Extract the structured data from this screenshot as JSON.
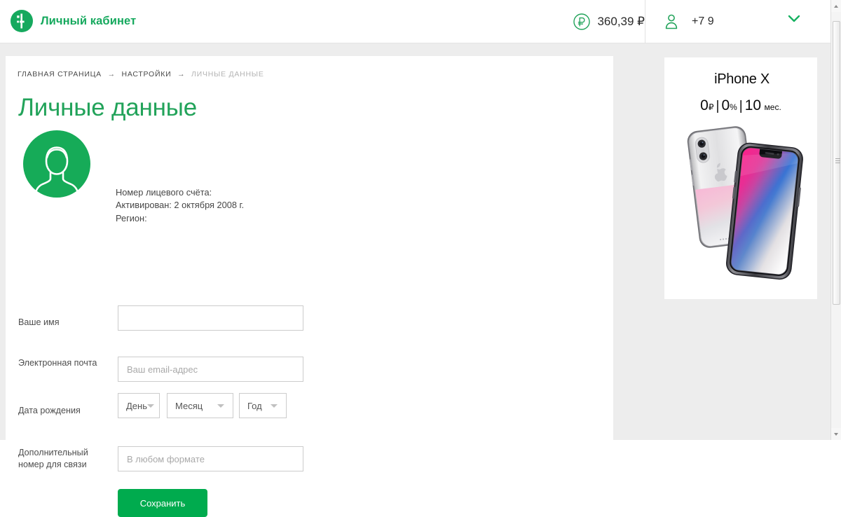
{
  "header": {
    "brand_name": "Личный кабинет",
    "logo_icon": "megafon-logo-icon",
    "balance": {
      "icon": "ruble-circle-icon",
      "amount": "360,39 ₽"
    },
    "user": {
      "icon": "person-icon",
      "phone": "+7 9",
      "chevron_icon": "chevron-down-icon"
    }
  },
  "breadcrumb": {
    "home": "ГЛАВНАЯ СТРАНИЦА",
    "settings": "НАСТРОЙКИ",
    "current": "ЛИЧНЫЕ ДАННЫЕ",
    "separator": "→"
  },
  "main": {
    "title": "Личные данные",
    "avatar_icon": "user-avatar-icon",
    "account": {
      "account_number_label": "Номер лицевого счёта:",
      "activated_label": "Активирован: 2 октября 2008 г.",
      "region_label": "Регион:"
    },
    "form": {
      "name": {
        "label": "Ваше имя",
        "value": "",
        "placeholder": ""
      },
      "email": {
        "label": "Электронная почта",
        "value": "",
        "placeholder": "Ваш email-адрес"
      },
      "birthdate": {
        "label": "Дата рождения",
        "day": "День",
        "month": "Месяц",
        "year": "Год"
      },
      "extra_phone": {
        "label": "Дополнительный номер для связи",
        "value": "",
        "placeholder": "В любом формате"
      },
      "submit_label": "Сохранить"
    }
  },
  "banner": {
    "apple_glyph": "",
    "product": "iPhone X",
    "price_amount": "0",
    "price_currency": "₽",
    "rate_amount": "0",
    "rate_unit": "%",
    "term_amount": "10",
    "term_unit": "мес.",
    "divider": "|",
    "image_alt": "iphone-x-devices"
  },
  "colors": {
    "brand_green": "#16a95e",
    "title_green": "#22a35a",
    "button_green": "#00ab4e",
    "page_bg": "#ededed",
    "card_bg": "#ffffff"
  }
}
